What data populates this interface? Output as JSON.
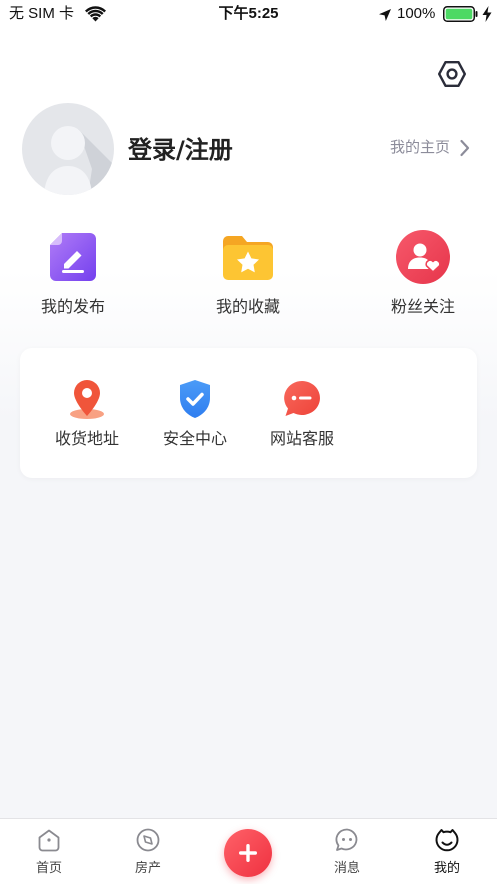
{
  "status_bar": {
    "carrier": "无 SIM 卡",
    "time": "下午5:25",
    "battery": "100%",
    "icons": [
      "wifi-icon",
      "location-arrow-icon",
      "battery-icon",
      "charging-bolt-icon"
    ]
  },
  "header": {
    "settings_icon": "settings-hexagon-icon"
  },
  "profile": {
    "avatar_icon": "default-avatar-icon",
    "login_label": "登录/注册",
    "homepage_link": "我的主页",
    "homepage_icon": "chevron-right-icon"
  },
  "quick_actions": [
    {
      "label": "我的发布",
      "icon": "edit-document-icon"
    },
    {
      "label": "我的收藏",
      "icon": "star-folder-icon"
    },
    {
      "label": "粉丝关注",
      "icon": "fans-heart-icon"
    }
  ],
  "services": [
    {
      "label": "收货地址",
      "icon": "location-pin-icon"
    },
    {
      "label": "安全中心",
      "icon": "shield-check-icon"
    },
    {
      "label": "网站客服",
      "icon": "chat-bubble-icon"
    }
  ],
  "tabbar": {
    "items": [
      {
        "label": "首页",
        "icon": "home-icon"
      },
      {
        "label": "房产",
        "icon": "compass-icon"
      },
      {
        "label": "消息",
        "icon": "message-icon"
      },
      {
        "label": "我的",
        "icon": "profile-face-icon"
      }
    ],
    "active": "我的",
    "center_button_icon": "plus-icon"
  },
  "colors": {
    "publish_purple": "#8a52f3",
    "favorite_yellow": "#fdc533",
    "fans_red": "#f0475a",
    "address_orange": "#f0553a",
    "security_blue": "#3d8ef5",
    "service_red": "#f2554a",
    "plus_red": "#ef3140",
    "battery_green": "#4cd964",
    "page_background": "#f5f6f9"
  }
}
